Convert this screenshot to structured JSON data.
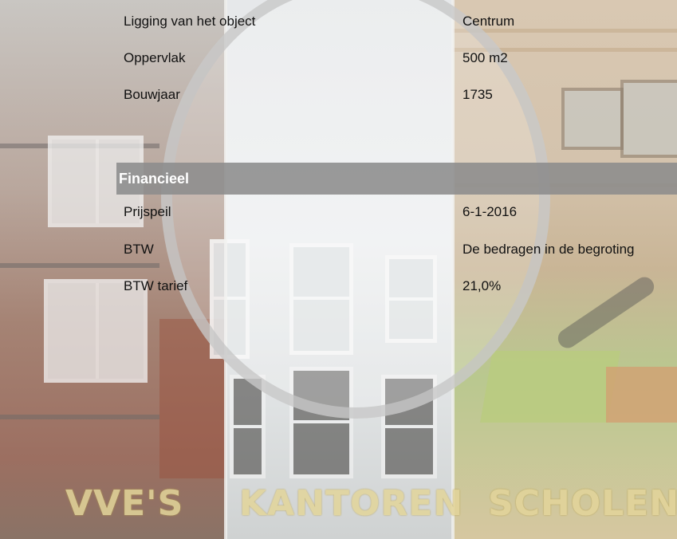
{
  "sections": [
    {
      "rows": [
        {
          "label": "Ligging van het object",
          "value": "Centrum"
        },
        {
          "label": "Oppervlak",
          "value": "500 m2"
        },
        {
          "label": "Bouwjaar",
          "value": "1735"
        }
      ]
    },
    {
      "header": "Financieel",
      "rows": [
        {
          "label": "Prijspeil",
          "value": "6-1-2016"
        },
        {
          "label": "BTW",
          "value": "De bedragen in de begroting"
        },
        {
          "label": "BTW tarief",
          "value": "21,0%"
        }
      ]
    }
  ],
  "watermarks": [
    "VVE'S",
    "KANTOREN",
    "SCHOLEN"
  ],
  "colors": {
    "header_bg": "#8c8c8c",
    "header_text": "#ffffff",
    "watermark": "#e3d59a"
  }
}
